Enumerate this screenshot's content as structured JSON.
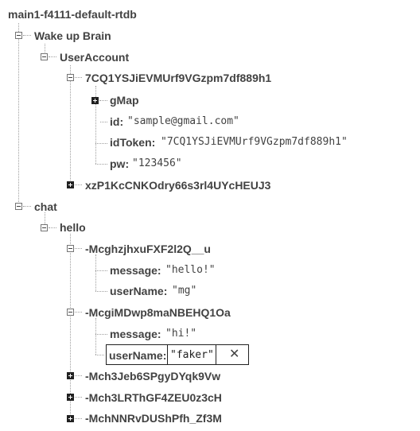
{
  "root": {
    "label": "main1-f4111-default-rtdb"
  },
  "wake_up_brain": {
    "label": "Wake up Brain",
    "user_account": {
      "label": "UserAccount",
      "user1": {
        "key": "7CQ1YSJiEVMUrf9VGzpm7df889h1",
        "gmap": "gMap",
        "id_key": "id:",
        "id_val": "\"sample@gmail.com\"",
        "idtoken_key": "idToken:",
        "idtoken_val": "\"7CQ1YSJiEVMUrf9VGzpm7df889h1\"",
        "pw_key": "pw:",
        "pw_val": "\"123456\""
      },
      "user2": {
        "key": "xzP1KcCNKOdry66s3rl4UYcHEUJ3"
      }
    }
  },
  "chat": {
    "label": "chat",
    "hello": {
      "label": "hello",
      "msg1": {
        "key": "-McghzjhxuFXF2l2Q__u",
        "message_key": "message:",
        "message_val": "\"hello!\"",
        "username_key": "userName:",
        "username_val": "\"mg\""
      },
      "msg2": {
        "key": "-McgiMDwp8maNBEHQ1Oa",
        "message_key": "message:",
        "message_val": "\"hi!\"",
        "username_key": "userName:",
        "username_edit_value": "\"faker\"",
        "close_glyph": "✕"
      },
      "msg3": {
        "key": "-Mch3Jeb6SPgyDYqk9Vw"
      },
      "msg4": {
        "key": "-Mch3LRThGF4ZEU0z3cH"
      },
      "msg5": {
        "key": "-MchNNRvDUShPfh_Zf3M"
      }
    }
  }
}
